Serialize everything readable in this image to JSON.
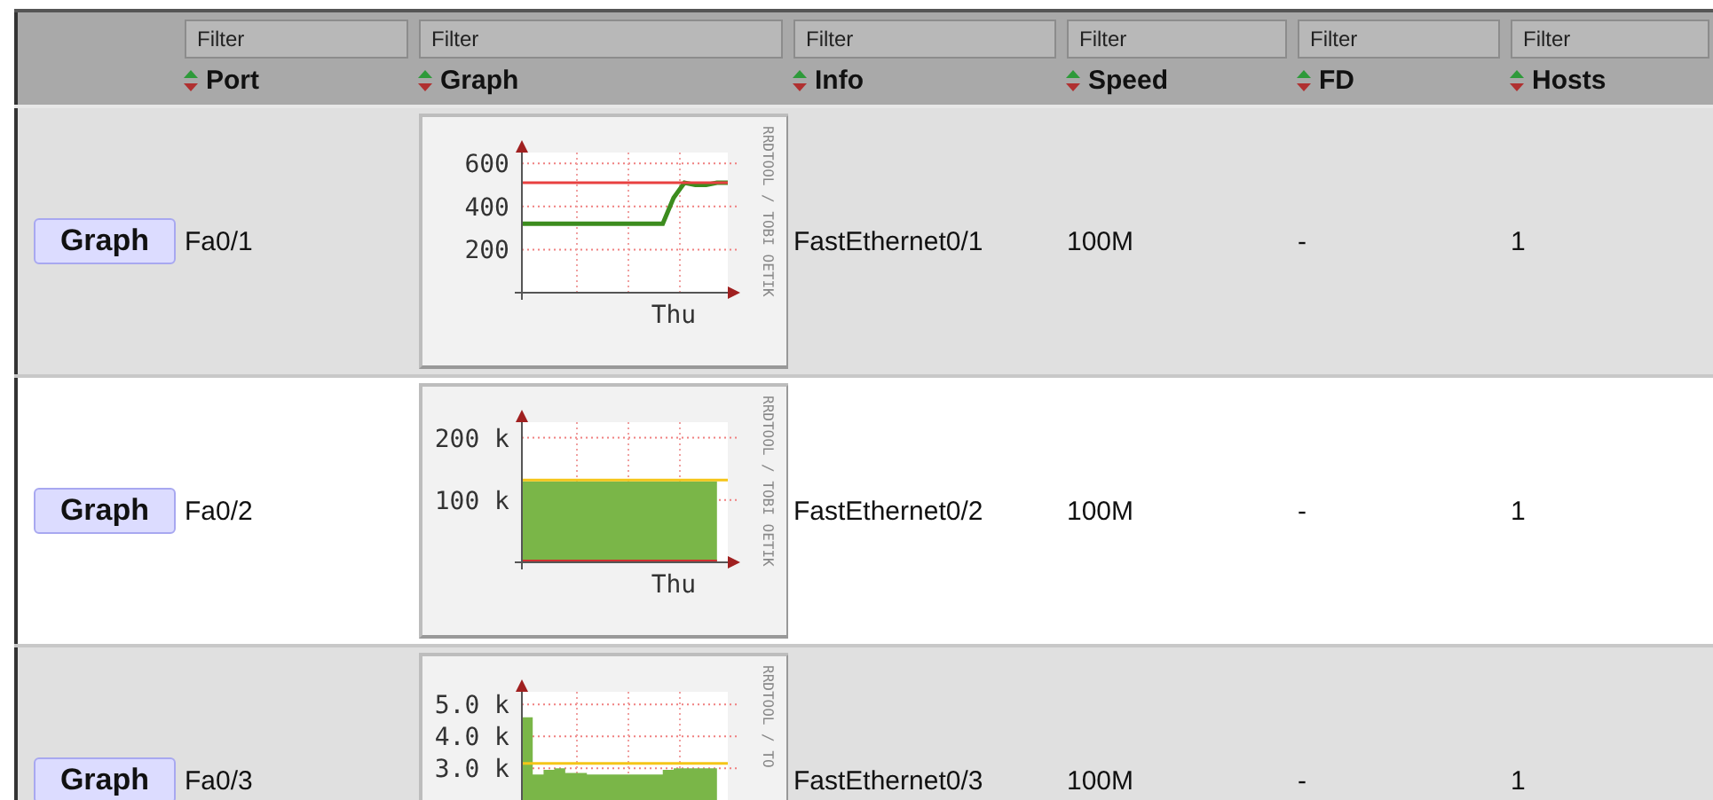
{
  "table": {
    "columns": [
      {},
      {
        "label": "Port",
        "placeholder": "Filter"
      },
      {
        "label": "Graph",
        "placeholder": "Filter"
      },
      {
        "label": "Info",
        "placeholder": "Filter"
      },
      {
        "label": "Speed",
        "placeholder": "Filter"
      },
      {
        "label": "FD",
        "placeholder": "Filter"
      },
      {
        "label": "Hosts",
        "placeholder": "Filter"
      }
    ],
    "rows": [
      {
        "button": "Graph",
        "port": "Fa0/1",
        "info": "FastEthernet0/1",
        "speed": "100M",
        "fd": "-",
        "hosts": "1",
        "graph_credit": "RRDTOOL / TOBI OETIK",
        "chart_data": {
          "type": "line",
          "grid": true,
          "ylim": [
            0,
            650
          ],
          "yticks": [
            {
              "value": 200,
              "label": "200"
            },
            {
              "value": 400,
              "label": "400"
            },
            {
              "value": 600,
              "label": "600"
            }
          ],
          "categories": [
            null,
            null,
            null,
            null,
            null,
            null,
            null,
            null,
            null,
            null,
            null,
            null,
            null,
            null,
            "Thu",
            null,
            null,
            null,
            null,
            null
          ],
          "series": [
            {
              "color": "#3c8c1e",
              "values": [
                320,
                320,
                320,
                320,
                320,
                320,
                320,
                320,
                320,
                320,
                320,
                320,
                320,
                320,
                440,
                510,
                500,
                500,
                510,
                510
              ]
            },
            {
              "color": "#e84040",
              "values": [
                510,
                510,
                510,
                510,
                510,
                510,
                510,
                510,
                510,
                510,
                510,
                510,
                510,
                510,
                510,
                510,
                510,
                510,
                510,
                510
              ]
            }
          ]
        }
      },
      {
        "button": "Graph",
        "port": "Fa0/2",
        "info": "FastEthernet0/2",
        "speed": "100M",
        "fd": "-",
        "hosts": "1",
        "graph_credit": "RRDTOOL / TOBI OETIK",
        "chart_data": {
          "type": "area",
          "grid": true,
          "ylim": [
            0,
            225
          ],
          "yticks": [
            {
              "value": 100,
              "label": "100 k"
            },
            {
              "value": 200,
              "label": "200 k"
            }
          ],
          "categories": [
            null,
            null,
            null,
            null,
            null,
            null,
            null,
            null,
            null,
            null,
            null,
            null,
            null,
            null,
            "Thu",
            null,
            null,
            null,
            null,
            null
          ],
          "series": [
            {
              "color": "#7ab648",
              "values": [
                130,
                130,
                130,
                130,
                130,
                130,
                130,
                130,
                130,
                130,
                130,
                130,
                130,
                130,
                130,
                130,
                130,
                130,
                130,
                null
              ]
            },
            {
              "type": "line",
              "color": "#f5c518",
              "values": [
                132,
                132,
                132,
                132,
                132,
                132,
                132,
                132,
                132,
                132,
                132,
                132,
                132,
                132,
                132,
                132,
                132,
                132,
                132,
                132
              ]
            },
            {
              "type": "line",
              "color": "#d03030",
              "values": [
                2,
                2,
                2,
                2,
                2,
                2,
                2,
                2,
                2,
                2,
                2,
                2,
                2,
                2,
                2,
                2,
                2,
                2,
                2,
                null
              ]
            }
          ]
        }
      },
      {
        "button": "Graph",
        "port": "Fa0/3",
        "info": "FastEthernet0/3",
        "speed": "100M",
        "fd": "-",
        "hosts": "1",
        "graph_credit": "RRDTOOL / TO",
        "chart_data": {
          "type": "area",
          "grid": true,
          "ylim": [
            1,
            5.4
          ],
          "yticks": [
            {
              "value": 3,
              "label": "3.0 k"
            },
            {
              "value": 4,
              "label": "4.0 k"
            },
            {
              "value": 5,
              "label": "5.0 k"
            }
          ],
          "series": [
            {
              "color": "#7ab648",
              "values": [
                4.6,
                2.8,
                2.95,
                3,
                2.85,
                2.85,
                2.8,
                2.8,
                2.8,
                2.8,
                2.8,
                2.8,
                2.8,
                2.95,
                3,
                3,
                3,
                3,
                2.95,
                null
              ]
            },
            {
              "type": "line",
              "color": "#f5c518",
              "values": [
                3.15,
                3.15,
                3.15,
                3.15,
                3.15,
                3.15,
                3.15,
                3.15,
                3.15,
                3.15,
                3.15,
                3.15,
                3.15,
                3.15,
                3.15,
                3.15,
                3.15,
                3.15,
                3.15,
                3.15
              ]
            }
          ]
        }
      }
    ]
  }
}
